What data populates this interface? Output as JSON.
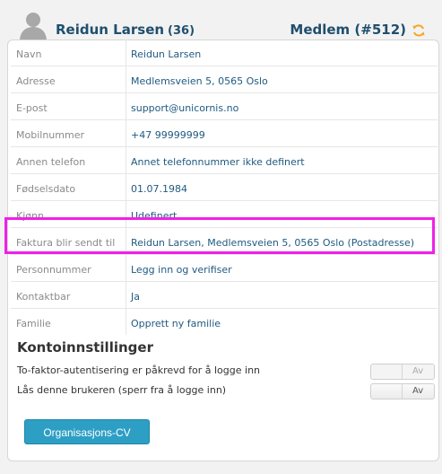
{
  "header": {
    "name": "Reidun Larsen",
    "age": "(36)",
    "member": "Medlem (#512)",
    "accent": "#1f4f6e",
    "refresh_icon_color": "#f5a623"
  },
  "details": [
    {
      "label": "Navn",
      "value": "Reidun Larsen"
    },
    {
      "label": "Adresse",
      "value": "Medlemsveien 5, 0565 Oslo"
    },
    {
      "label": "E-post",
      "value": "support@unicornis.no"
    },
    {
      "label": "Mobilnummer",
      "value": "+47 99999999"
    },
    {
      "label": "Annen telefon",
      "value": "Annet telefonnummer ikke definert"
    },
    {
      "label": "Fødselsdato",
      "value": "01.07.1984"
    },
    {
      "label": "Kjønn",
      "value": "Udefinert"
    },
    {
      "label": "Faktura blir sendt til",
      "value": "Reidun Larsen, Medlemsveien 5, 0565 Oslo (Postadresse)"
    },
    {
      "label": "Personnummer",
      "value": "Legg inn og verifiser"
    },
    {
      "label": "Kontaktbar",
      "value": "Ja"
    },
    {
      "label": "Familie",
      "value": "Opprett ny familie"
    }
  ],
  "account": {
    "title": "Kontoinnstillinger",
    "settings": [
      {
        "label": "To-faktor-autentisering er påkrevd for å logge inn",
        "state": "Av"
      },
      {
        "label": "Lås denne brukeren (sperr fra å logge inn)",
        "state": "Av"
      }
    ]
  },
  "actions": {
    "cv_button": "Organisasjons-CV",
    "button_color": "#2e9fc4"
  },
  "highlight_color": "#f020e8"
}
